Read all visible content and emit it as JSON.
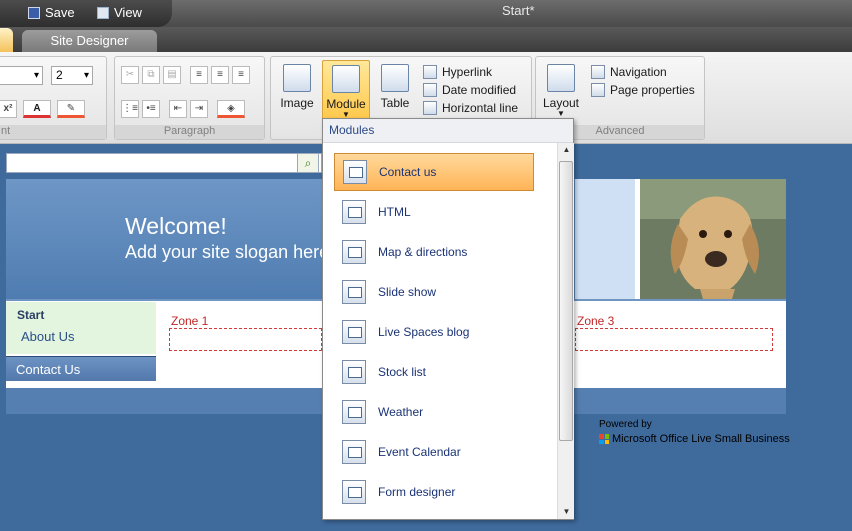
{
  "titlebar": {
    "save_label": "Save",
    "view_label": "View",
    "document_title": "Start*"
  },
  "tabs": {
    "site_designer": "Site Designer"
  },
  "ribbon": {
    "font_size": "2",
    "groups": {
      "font_label_partial": "nt",
      "paragraph_label": "Paragraph",
      "advanced_label": "Advanced"
    },
    "buttons": {
      "image": "Image",
      "module": "Module",
      "table": "Table",
      "hyperlink": "Hyperlink",
      "date_modified": "Date modified",
      "horizontal_line": "Horizontal line",
      "layout": "Layout",
      "navigation": "Navigation",
      "page_properties": "Page properties"
    }
  },
  "site": {
    "welcome": "Welcome!",
    "slogan": "Add your site slogan here",
    "nav": {
      "start": "Start",
      "about": "About Us",
      "contact": "Contact Us"
    },
    "zone1": "Zone 1",
    "zone3": "Zone 3",
    "powered_by": "Powered by",
    "powered_brand": "Microsoft Office Live Small Business"
  },
  "modules_menu": {
    "header": "Modules",
    "items": [
      {
        "label": "Contact us",
        "icon": "contact-form-icon",
        "selected": true
      },
      {
        "label": "HTML",
        "icon": "html-icon",
        "selected": false
      },
      {
        "label": "Map & directions",
        "icon": "map-icon",
        "selected": false
      },
      {
        "label": "Slide show",
        "icon": "slideshow-icon",
        "selected": false
      },
      {
        "label": "Live Spaces blog",
        "icon": "blog-icon",
        "selected": false
      },
      {
        "label": "Stock list",
        "icon": "stock-chart-icon",
        "selected": false
      },
      {
        "label": "Weather",
        "icon": "weather-icon",
        "selected": false
      },
      {
        "label": "Event Calendar",
        "icon": "calendar-icon",
        "selected": false
      },
      {
        "label": "Form designer",
        "icon": "form-icon",
        "selected": false
      }
    ]
  },
  "colors": {
    "accent_orange": "#ffb457",
    "page_blue": "#3f6a9c",
    "zone_red": "#d23a3a"
  }
}
